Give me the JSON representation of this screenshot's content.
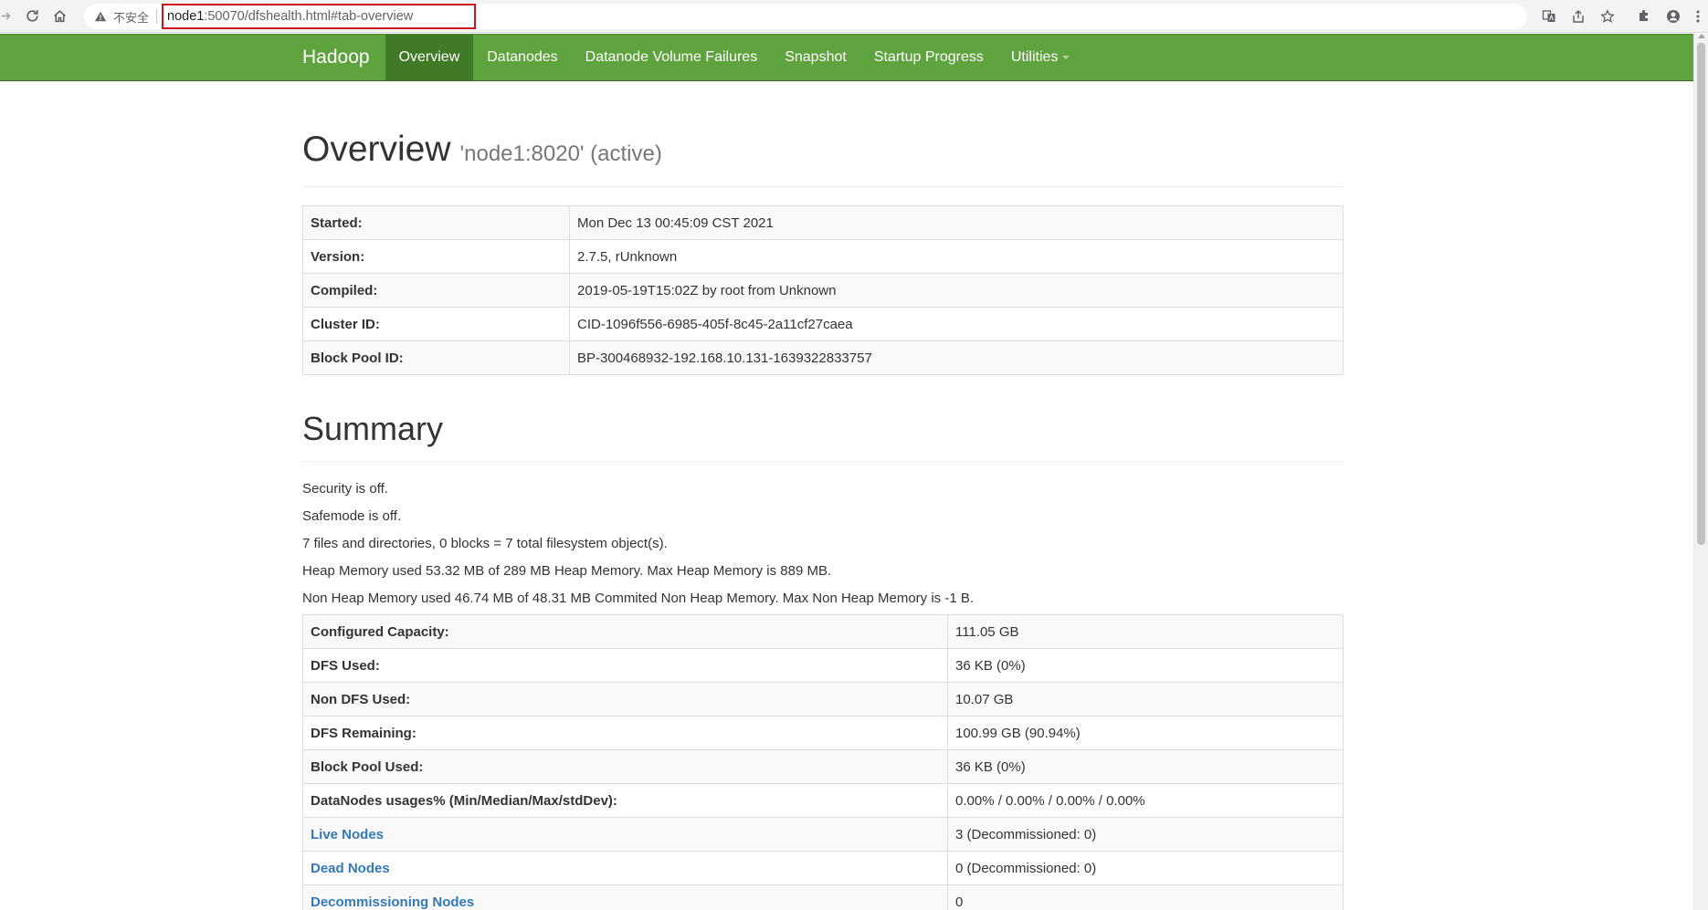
{
  "browser": {
    "security_label": "不安全",
    "url_host": "node1",
    "url_rest": ":50070/dfshealth.html#tab-overview"
  },
  "navbar": {
    "brand": "Hadoop",
    "items": [
      {
        "label": "Overview",
        "active": true
      },
      {
        "label": "Datanodes"
      },
      {
        "label": "Datanode Volume Failures"
      },
      {
        "label": "Snapshot"
      },
      {
        "label": "Startup Progress"
      },
      {
        "label": "Utilities"
      }
    ]
  },
  "overview": {
    "title": "Overview",
    "subtitle": "'node1:8020' (active)",
    "rows": [
      {
        "key": "Started:",
        "value": "Mon Dec 13 00:45:09 CST 2021"
      },
      {
        "key": "Version:",
        "value": "2.7.5, rUnknown"
      },
      {
        "key": "Compiled:",
        "value": "2019-05-19T15:02Z by root from Unknown"
      },
      {
        "key": "Cluster ID:",
        "value": "CID-1096f556-6985-405f-8c45-2a11cf27caea"
      },
      {
        "key": "Block Pool ID:",
        "value": "BP-300468932-192.168.10.131-1639322833757"
      }
    ]
  },
  "summary": {
    "title": "Summary",
    "lines": [
      "Security is off.",
      "Safemode is off.",
      "7 files and directories, 0 blocks = 7 total filesystem object(s).",
      "Heap Memory used 53.32 MB of 289 MB Heap Memory. Max Heap Memory is 889 MB.",
      "Non Heap Memory used 46.74 MB of 48.31 MB Commited Non Heap Memory. Max Non Heap Memory is -1 B."
    ],
    "rows": [
      {
        "key": "Configured Capacity:",
        "value": "111.05 GB"
      },
      {
        "key": "DFS Used:",
        "value": "36 KB (0%)"
      },
      {
        "key": "Non DFS Used:",
        "value": "10.07 GB"
      },
      {
        "key": "DFS Remaining:",
        "value": "100.99 GB (90.94%)"
      },
      {
        "key": "Block Pool Used:",
        "value": "36 KB (0%)"
      },
      {
        "key": "DataNodes usages% (Min/Median/Max/stdDev):",
        "value": "0.00% / 0.00% / 0.00% / 0.00%"
      },
      {
        "key": "Live Nodes",
        "value": "3 (Decommissioned: 0)",
        "link": true
      },
      {
        "key": "Dead Nodes",
        "value": "0 (Decommissioned: 0)",
        "link": true
      },
      {
        "key": "Decommissioning Nodes",
        "value": "0",
        "link": true
      }
    ]
  }
}
